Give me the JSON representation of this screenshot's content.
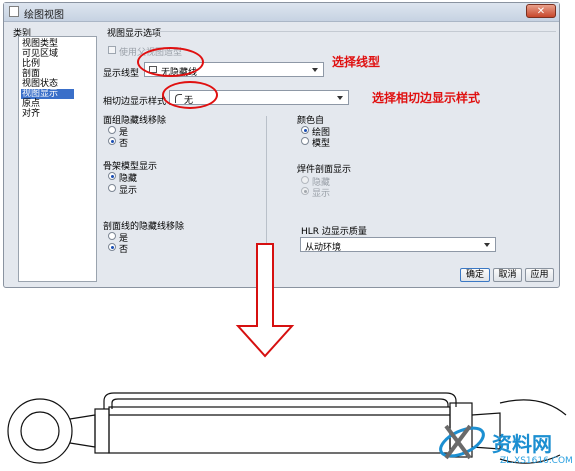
{
  "window": {
    "title": "绘图视图",
    "close_glyph": "✕"
  },
  "categories": {
    "label": "类别",
    "items": [
      "视图类型",
      "可见区域",
      "比例",
      "剖面",
      "视图状态",
      "视图显示",
      "原点",
      "对齐"
    ],
    "selected": "视图显示"
  },
  "options": {
    "group_label": "视图显示选项",
    "use_parent_checkbox": "使用父视图造型",
    "display_style_label": "显示线型",
    "display_style_value": "无隐藏线",
    "tangent_edge_label": "相切边显示样式",
    "tangent_edge_value": "无",
    "face_hidden": {
      "label": "面组隐藏线移除",
      "options": [
        "是",
        "否"
      ],
      "selected": "否"
    },
    "skeleton": {
      "label": "骨架模型显示",
      "options": [
        "隐藏",
        "显示"
      ],
      "selected": "隐藏"
    },
    "section_hidden": {
      "label": "剖面线的隐藏线移除",
      "options": [
        "是",
        "否"
      ],
      "selected": "否"
    },
    "color_from": {
      "label": "颜色自",
      "options": [
        "绘图",
        "模型"
      ],
      "selected": "绘图"
    },
    "weld_section": {
      "label": "焊件剖面显示",
      "options": [
        "隐藏",
        "显示"
      ],
      "selected": "显示"
    },
    "hlr_quality": {
      "label": "HLR 边显示质量",
      "value": "从动环境"
    }
  },
  "buttons": {
    "ok": "确定",
    "cancel": "取消",
    "apply": "应用"
  },
  "annotations": {
    "line_style": "选择线型",
    "tangent_style": "选择相切边显示样式"
  },
  "watermark": {
    "brand": "资料网",
    "url": "ZL.XS1616.COM"
  },
  "colors": {
    "annotation_red": "#e01010",
    "selection_blue": "#3a6fc9",
    "watermark_blue": "#1c8fd1"
  }
}
